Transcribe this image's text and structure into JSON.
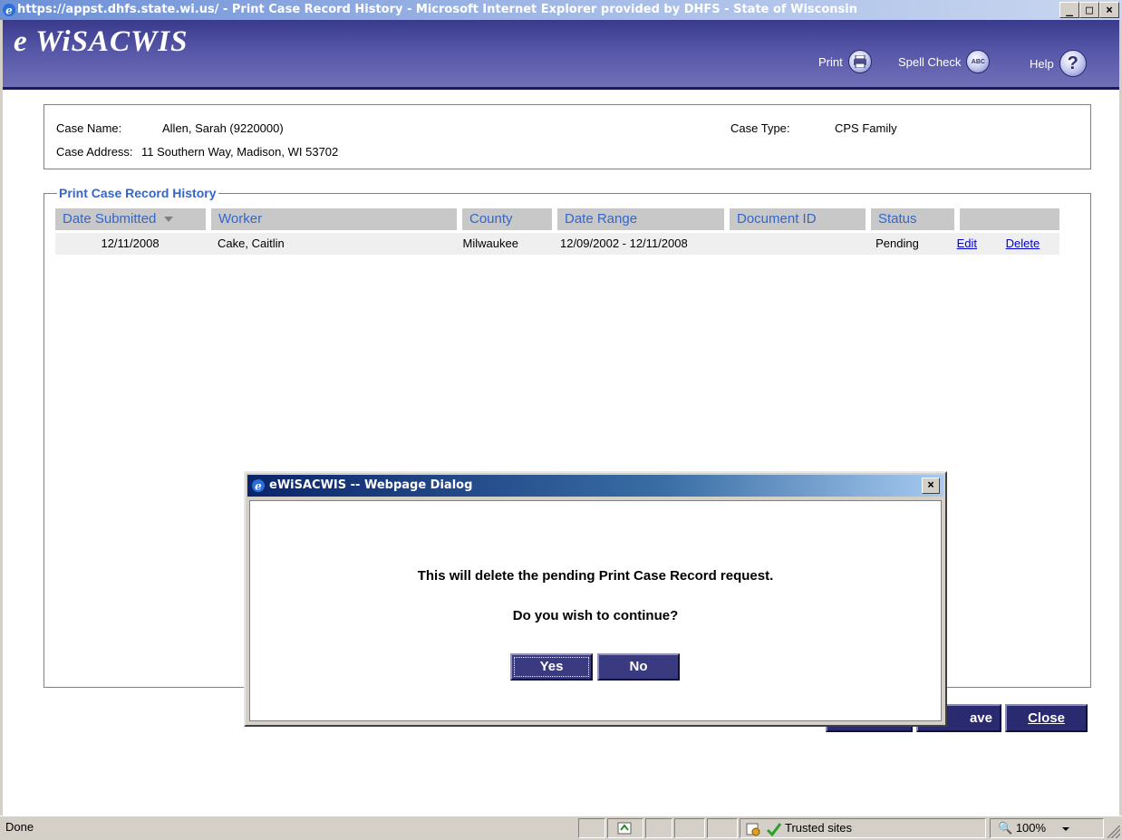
{
  "window": {
    "title": "https://appst.dhfs.state.wi.us/ - Print Case Record History - Microsoft Internet Explorer provided by DHFS - State of Wisconsin",
    "minimize": "_",
    "maximize": "□",
    "close": "×"
  },
  "header": {
    "logo": "e WiSACWIS",
    "print_label": "Print",
    "spellcheck_label": "Spell Check",
    "spellcheck_icon_text": "ABC",
    "help_label": "Help",
    "help_icon_text": "?"
  },
  "case": {
    "name_label": "Case Name:",
    "name_value": "Allen, Sarah (9220000)",
    "address_label": "Case Address:",
    "address_value": "11 Southern Way, Madison, WI 53702",
    "type_label": "Case Type:",
    "type_value": "CPS Family"
  },
  "history": {
    "legend": "Print Case Record History",
    "columns": [
      "Date Submitted",
      "Worker",
      "County",
      "Date Range",
      "Document ID",
      "Status",
      ""
    ],
    "rows": [
      {
        "date_submitted": "12/11/2008",
        "worker": "Cake, Caitlin",
        "county": "Milwaukee",
        "date_range": "12/09/2002 - 12/11/2008",
        "document_id": "",
        "status": "Pending",
        "edit": "Edit",
        "delete": "Delete"
      }
    ]
  },
  "page_buttons": {
    "save_label": "ave",
    "close_label": "Close"
  },
  "dialog": {
    "title": "eWiSACWIS -- Webpage Dialog",
    "close": "×",
    "message1": "This will delete the pending Print Case Record request.",
    "message2": "Do you wish to continue?",
    "yes_label": "Yes",
    "no_label": "No"
  },
  "status_bar": {
    "status_text": "Done",
    "zone": "Trusted sites",
    "zoom": "100%"
  }
}
